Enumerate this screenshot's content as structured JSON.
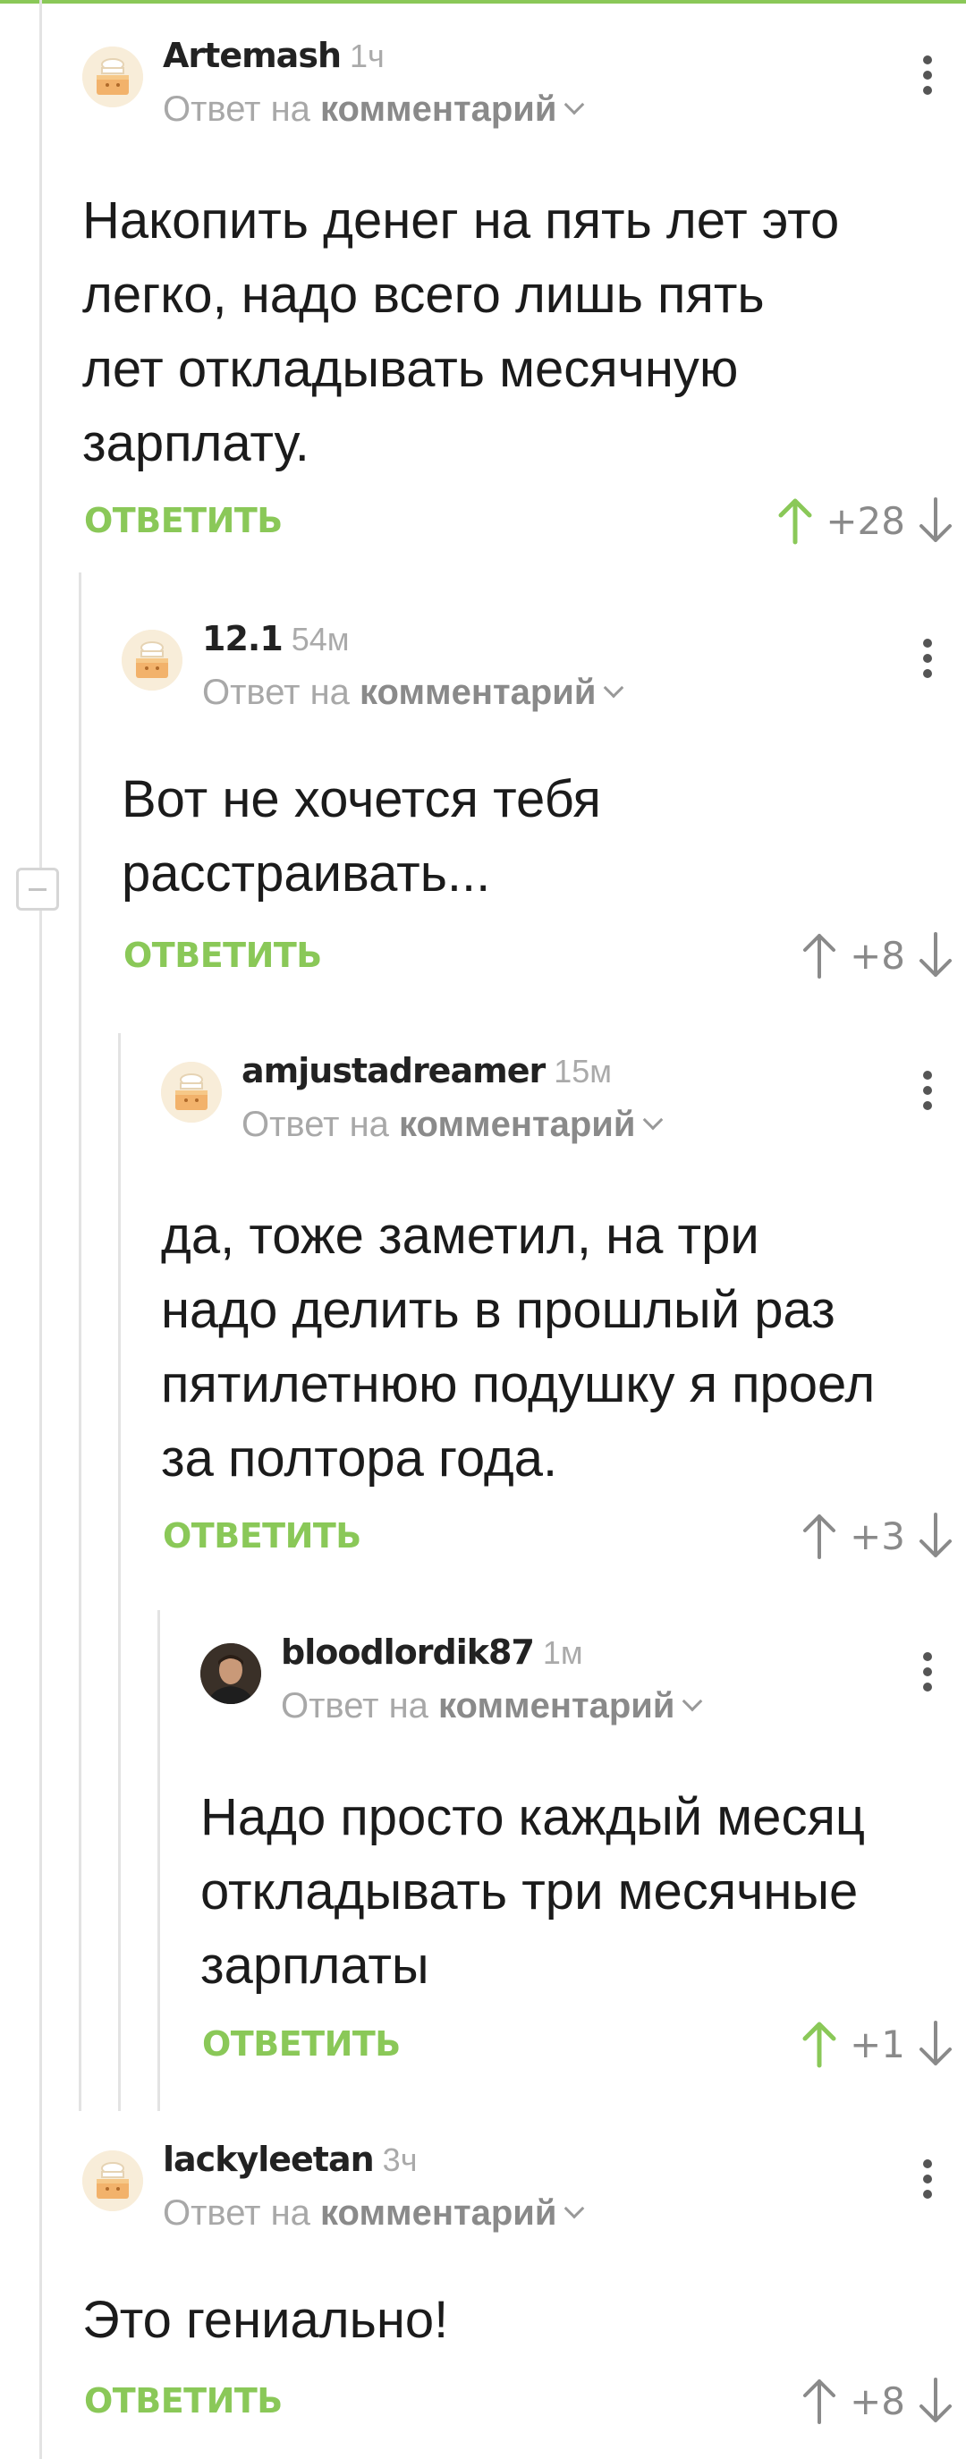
{
  "reply_label": "ОТВЕТИТЬ",
  "reply_prefix": "Ответ на",
  "reply_link": "комментарий",
  "colors": {
    "accent": "#8ac858",
    "vote_up_active": "#8ac858",
    "vote_neutral": "#8a8a8a",
    "thread_line": "#e3e3e3"
  },
  "comments": [
    {
      "author": "Artemash",
      "time": "1ч",
      "avatar": "default-avatar-icon",
      "lines": [
        "Накопить денег на пять лет это",
        "легко, надо всего лишь пять",
        "лет откладывать месячную",
        "зарплату."
      ],
      "score": "+28",
      "upvoted": true
    },
    {
      "author": "12.1",
      "time": "54м",
      "avatar": "default-avatar-icon",
      "lines": [
        "Вот не хочется тебя",
        "расстраивать..."
      ],
      "score": "+8",
      "upvoted": false
    },
    {
      "author": "amjustadreamer",
      "time": "15м",
      "avatar": "default-avatar-icon",
      "lines": [
        "да, тоже заметил, на три",
        "надо делить в прошлый раз",
        "пятилетнюю подушку я проел",
        "за полтора года."
      ],
      "score": "+3",
      "upvoted": false
    },
    {
      "author": "bloodlordik87",
      "time": "1м",
      "avatar": "user-photo-avatar",
      "lines": [
        "Надо просто каждый месяц",
        "откладывать три месячные",
        "зарплаты"
      ],
      "score": "+1",
      "upvoted": true
    },
    {
      "author": "lackyleetan",
      "time": "3ч",
      "avatar": "default-avatar-icon",
      "lines": [
        "Это гениально!"
      ],
      "score": "+8",
      "upvoted": false
    }
  ]
}
